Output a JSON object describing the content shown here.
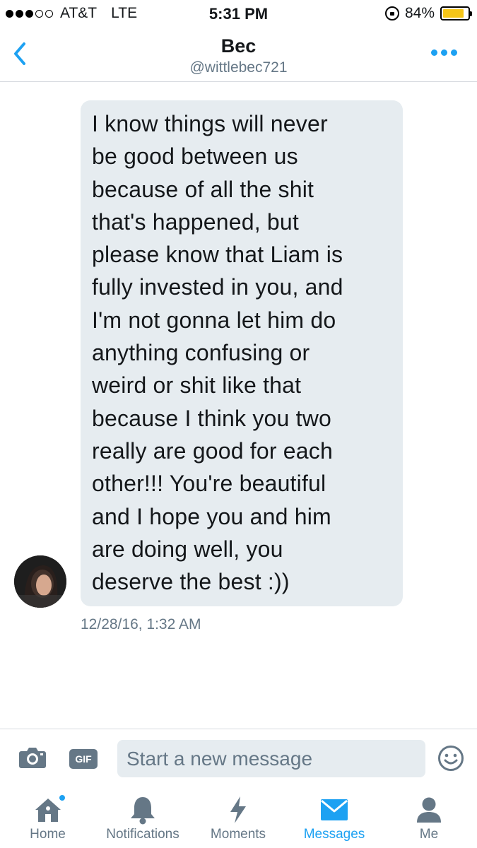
{
  "status_bar": {
    "carrier": "AT&T",
    "network": "LTE",
    "time": "5:31 PM",
    "battery_percent": "84%",
    "battery_level": 0.84,
    "signal_bars_filled": 3,
    "signal_bars_total": 5
  },
  "header": {
    "name": "Bec",
    "handle": "@wittlebec721",
    "back_icon": "chevron-left-icon",
    "more_icon": "more-dots-icon"
  },
  "conversation": {
    "messages": [
      {
        "text": "I know things will never\nbe good between us\nbecause of all the shit\nthat's happened, but\nplease know that Liam is\nfully invested in you, and\nI'm not gonna let him do\nanything confusing or\nweird or shit like that\nbecause I think you two\nreally are good for each\nother!!! You're beautiful\nand I hope you and him\nare doing well, you\ndeserve the best :))",
        "timestamp": "12/28/16, 1:32 AM"
      }
    ]
  },
  "composer": {
    "placeholder": "Start a new message",
    "gif_label": "GIF"
  },
  "tabbar": {
    "tabs": [
      {
        "label": "Home",
        "icon": "home-icon",
        "active": false,
        "badge": true
      },
      {
        "label": "Notifications",
        "icon": "bell-icon",
        "active": false,
        "badge": false
      },
      {
        "label": "Moments",
        "icon": "lightning-icon",
        "active": false,
        "badge": false
      },
      {
        "label": "Messages",
        "icon": "envelope-icon",
        "active": true,
        "badge": false
      },
      {
        "label": "Me",
        "icon": "person-icon",
        "active": false,
        "badge": false
      }
    ]
  },
  "colors": {
    "accent": "#1da1f2",
    "muted": "#657786",
    "bubble": "#e6ecf0",
    "battery": "#f5c518"
  }
}
